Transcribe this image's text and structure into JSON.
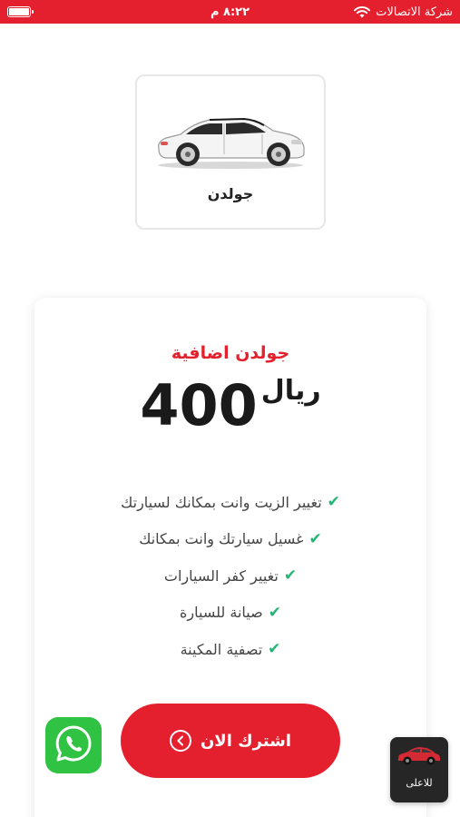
{
  "status_bar": {
    "carrier": "شركة الاتصالات",
    "time": "٨:٢٢ م",
    "battery_level": 1.0,
    "icons": [
      "wifi-icon",
      "battery-icon"
    ]
  },
  "package": {
    "name": "جولدن",
    "image": "car-icon"
  },
  "plan": {
    "title": "جولدن اضافية",
    "price": "400",
    "currency": "ريال",
    "features": [
      "تغيير الزيت وانت بمكانك لسيارتك",
      "غسيل سيارتك وانت بمكانك",
      "تغيير كفر السيارات",
      "صيانة للسيارة",
      "تصفية المكينة"
    ],
    "subscribe_label": "اشترك الان"
  },
  "floating": {
    "whatsapp": "whatsapp-icon",
    "to_top_label": "للاعلى"
  },
  "colors": {
    "accent": "#e5202e",
    "check": "#22b573",
    "whatsapp": "#2fc243",
    "dark": "#262626"
  }
}
